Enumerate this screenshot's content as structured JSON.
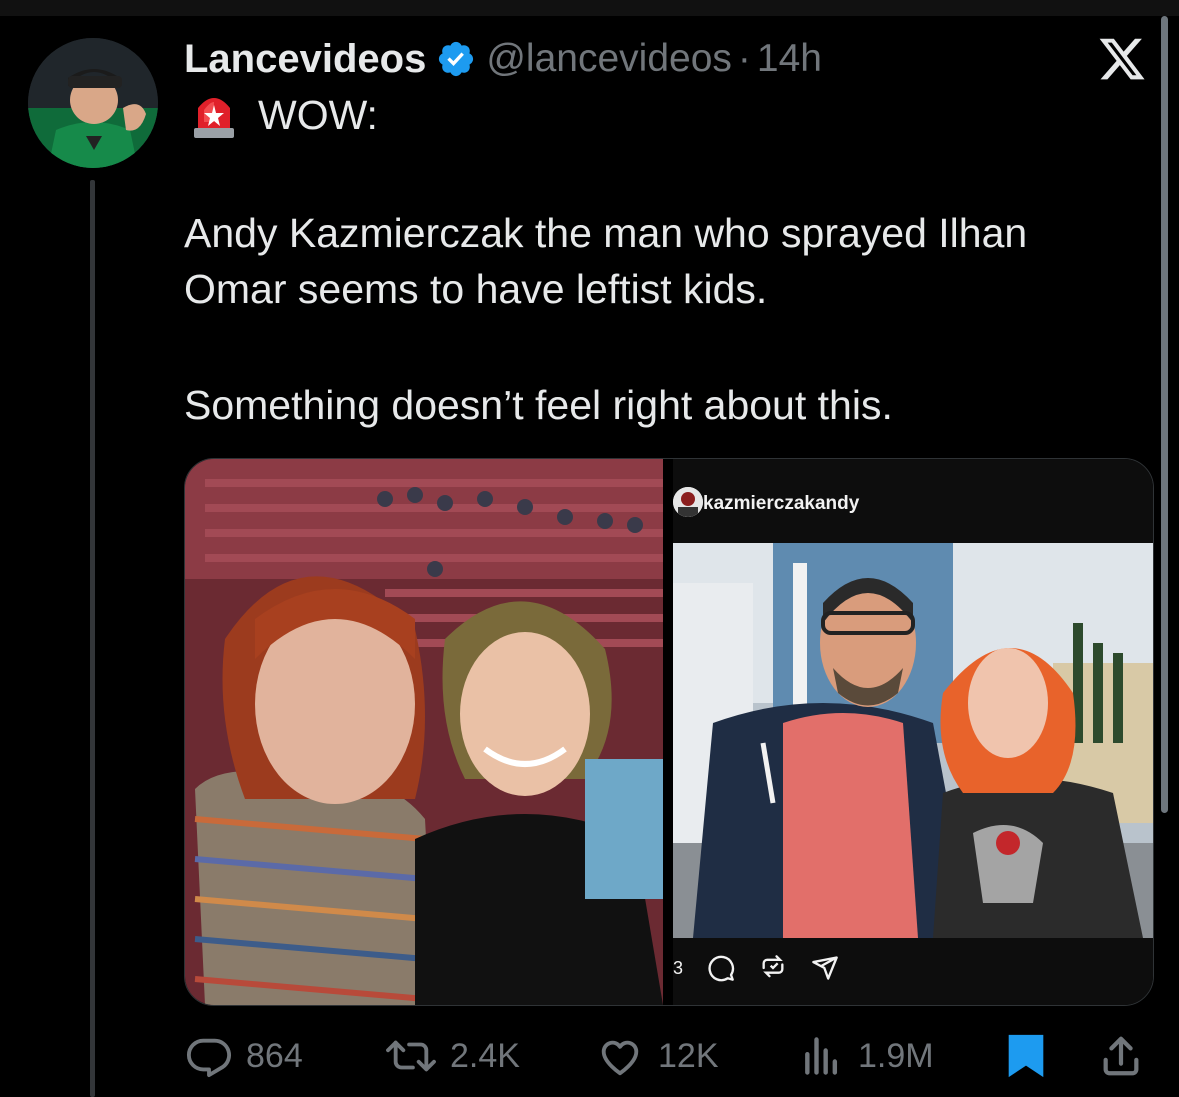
{
  "post": {
    "display_name": "Lancevideos",
    "handle": "@lancevideos",
    "separator": "·",
    "time": "14h",
    "siren_icon": "police-car-light-icon",
    "lines": {
      "wow": "WOW:",
      "line1": "Andy Kazmierczak the man who sprayed Ilhan",
      "line2": "Omar seems to have leftist kids.",
      "line3": "Something doesn’t feel right about this."
    }
  },
  "media": {
    "right": {
      "username": "kazmierczakandy",
      "comment_count": "3"
    }
  },
  "actions": {
    "replies": "864",
    "reposts": "2.4K",
    "likes": "12K",
    "views": "1.9M"
  },
  "colors": {
    "accent": "#1d9bf0",
    "muted": "#71767b",
    "text": "#e7e9ea"
  }
}
